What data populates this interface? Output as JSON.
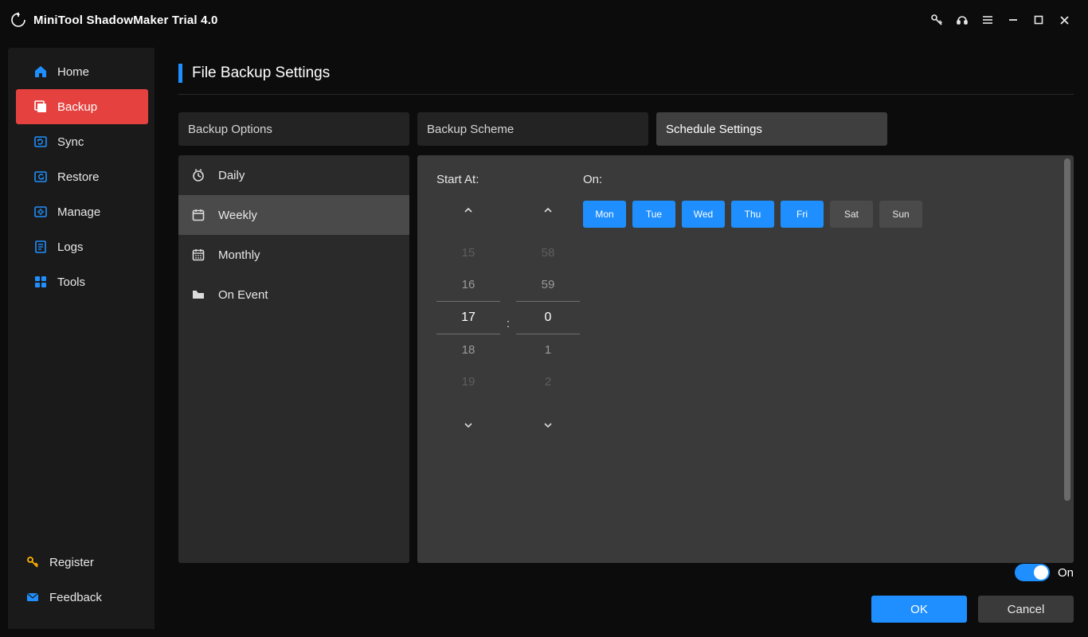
{
  "app": {
    "title": "MiniTool ShadowMaker Trial 4.0"
  },
  "sidebar": {
    "items": [
      {
        "label": "Home"
      },
      {
        "label": "Backup"
      },
      {
        "label": "Sync"
      },
      {
        "label": "Restore"
      },
      {
        "label": "Manage"
      },
      {
        "label": "Logs"
      },
      {
        "label": "Tools"
      }
    ],
    "bottom": {
      "register": "Register",
      "feedback": "Feedback"
    }
  },
  "page": {
    "title": "File Backup Settings",
    "tabs": [
      {
        "label": "Backup Options"
      },
      {
        "label": "Backup Scheme"
      },
      {
        "label": "Schedule Settings"
      }
    ]
  },
  "modes": [
    {
      "label": "Daily"
    },
    {
      "label": "Weekly"
    },
    {
      "label": "Monthly"
    },
    {
      "label": "On Event"
    }
  ],
  "schedule": {
    "start_at_label": "Start At:",
    "on_label": "On:",
    "separator": ":",
    "hour": {
      "v0": "15",
      "v1": "16",
      "sel": "17",
      "v3": "18",
      "v4": "19"
    },
    "minute": {
      "v0": "58",
      "v1": "59",
      "sel": "0",
      "v3": "1",
      "v4": "2"
    },
    "days": [
      {
        "label": "Mon",
        "on": true
      },
      {
        "label": "Tue",
        "on": true
      },
      {
        "label": "Wed",
        "on": true
      },
      {
        "label": "Thu",
        "on": true
      },
      {
        "label": "Fri",
        "on": true
      },
      {
        "label": "Sat",
        "on": false
      },
      {
        "label": "Sun",
        "on": false
      }
    ]
  },
  "footer": {
    "toggle_label": "On",
    "ok": "OK",
    "cancel": "Cancel"
  }
}
